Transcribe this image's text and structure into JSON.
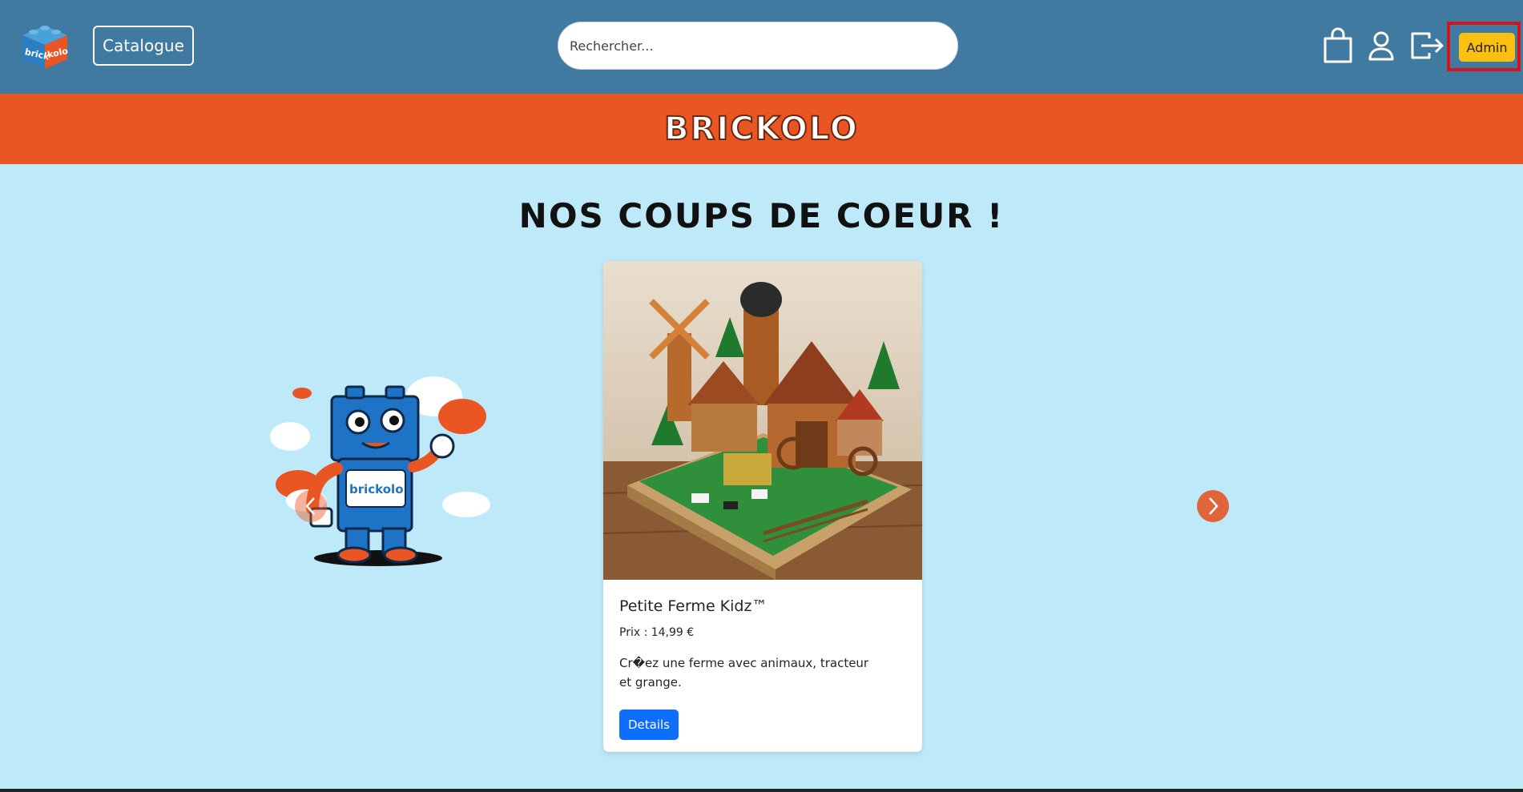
{
  "navbar": {
    "logo_alt": "brick kolo",
    "catalogue_label": "Catalogue",
    "search_placeholder": "Rechercher...",
    "admin_label": "Admin"
  },
  "banner": {
    "title": "BRICKOLO"
  },
  "section": {
    "title": "NOS COUPS DE COEUR !"
  },
  "carousel": {
    "mascot_text": "brickolo",
    "product": {
      "name": "Petite Ferme Kidz™",
      "price": "Prix : 14,99 €",
      "description": "Cr�ez une ferme avec animaux, tracteur et grange.",
      "details_label": "Details"
    }
  },
  "colors": {
    "navbar": "#417aa0",
    "banner": "#e95624",
    "page_bg": "#bde9f8",
    "admin_button": "#fbbf10",
    "highlight_box": "#d4141b",
    "details_button": "#0d6efd"
  }
}
